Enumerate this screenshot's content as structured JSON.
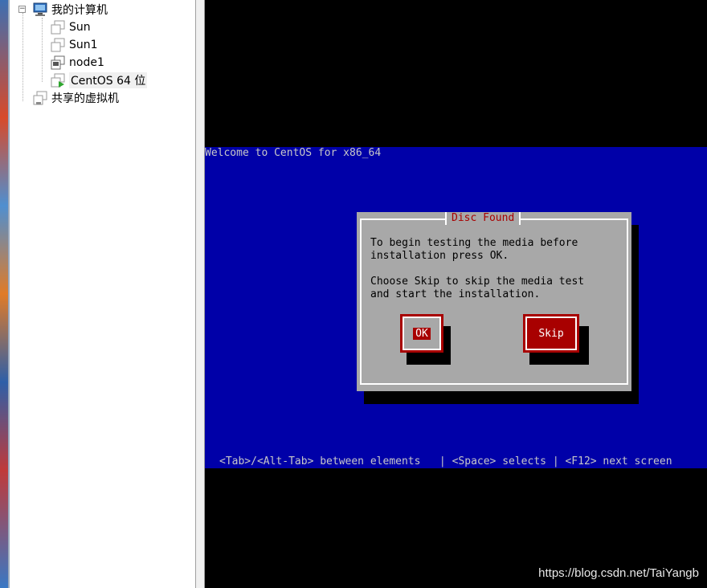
{
  "tree": {
    "root": {
      "label": "我的计算机",
      "expander": "−"
    },
    "vms": [
      {
        "label": "Sun",
        "icon": "vm-icon"
      },
      {
        "label": "Sun1",
        "icon": "vm-icon"
      },
      {
        "label": "node1",
        "icon": "vm-running-icon"
      },
      {
        "label": "CentOS 64 位",
        "icon": "vm-powered-on-icon",
        "selected": true
      }
    ],
    "shared": {
      "label": "共享的虚拟机",
      "icon": "shared-vm-icon"
    }
  },
  "console": {
    "welcome": "Welcome to CentOS for x86_64",
    "dialog": {
      "title": "Disc Found",
      "text1": "To begin testing the media before\ninstallation press OK.",
      "text2": "Choose Skip to skip the media test\nand start the installation.",
      "ok_label": "OK",
      "skip_label": "Skip"
    },
    "help": "<Tab>/<Alt-Tab> between elements   | <Space> selects | <F12> next screen"
  },
  "watermark": "https://blog.csdn.net/TaiYangb",
  "colors": {
    "console_blue": "#0000a8",
    "dialog_gray": "#a8a8a8",
    "button_red": "#a80000",
    "title_red": "#a80000"
  }
}
